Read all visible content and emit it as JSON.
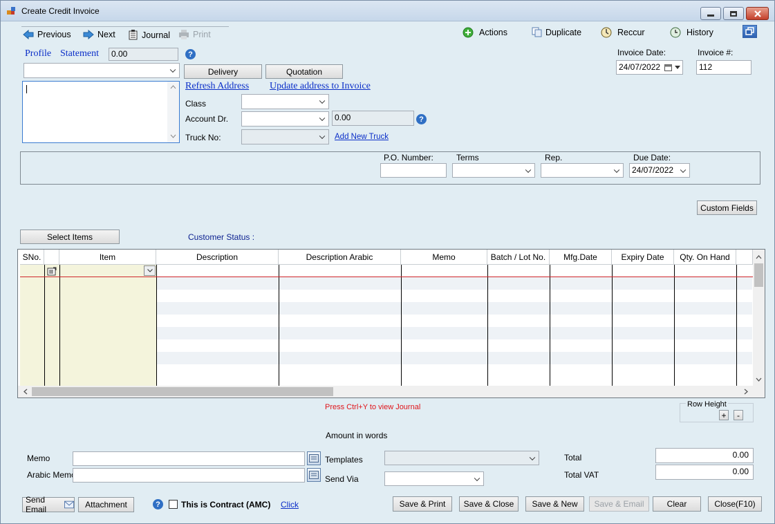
{
  "window": {
    "title": "Create Credit Invoice"
  },
  "toolbar": {
    "previous": "Previous",
    "next": "Next",
    "journal": "Journal",
    "print": "Print",
    "actions": "Actions",
    "duplicate": "Duplicate",
    "reccur": "Reccur",
    "history": "History"
  },
  "customer": {
    "profile": "Profile",
    "statement": "Statement",
    "balance": "0.00",
    "name_value": "",
    "address_value": "",
    "delivery": "Delivery",
    "quotation": "Quotation",
    "refresh_address": "Refresh Address",
    "update_address": "Update address to Invoice"
  },
  "details": {
    "class_label": "Class",
    "account_label": "Account Dr.",
    "account_balance": "0.00",
    "truck_label": "Truck No:",
    "add_truck": "Add New Truck"
  },
  "invoice": {
    "date_label": "Invoice Date:",
    "date_value": "24/07/2022",
    "number_label": "Invoice #:",
    "number_value": "112"
  },
  "terms": {
    "po_label": "P.O. Number:",
    "terms_label": "Terms",
    "rep_label": "Rep.",
    "due_label": "Due Date:",
    "due_value": "24/07/2022"
  },
  "custom_fields": "Custom Fields",
  "select_items": "Select Items",
  "customer_status": "Customer Status :",
  "grid": {
    "columns": [
      "SNo.",
      "",
      "Item",
      "Description",
      "Description Arabic",
      "Memo",
      "Batch / Lot No.",
      "Mfg.Date",
      "Expiry Date",
      "Qty. On Hand"
    ]
  },
  "journal_hint": "Press Ctrl+Y to view Journal",
  "row_height": {
    "label": "Row Height",
    "plus": "+",
    "minus": "-"
  },
  "amount_in_words": "Amount in words",
  "bottom": {
    "memo_label": "Memo",
    "arabic_memo_label": "Arabic Memo",
    "templates_label": "Templates",
    "send_via_label": "Send Via",
    "total_label": "Total",
    "total_value": "0.00",
    "vat_label": "Total VAT",
    "vat_value": "0.00"
  },
  "footer": {
    "send_email": "Send Email",
    "attachment": "Attachment",
    "contract": "This is Contract (AMC)",
    "click": "Click",
    "save_print": "Save & Print",
    "save_close": "Save & Close",
    "save_new": "Save & New",
    "save_email": "Save & Email",
    "clear": "Clear",
    "close": "Close(F10)"
  }
}
